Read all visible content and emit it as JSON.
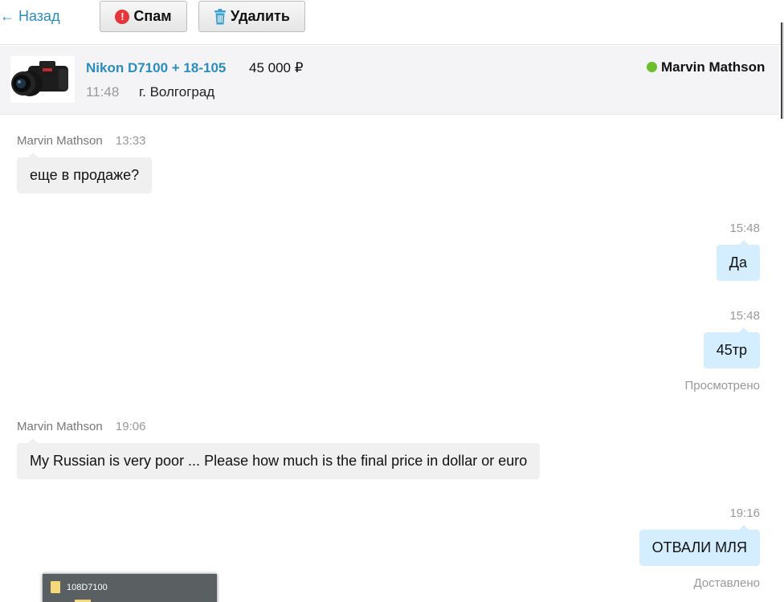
{
  "toolbar": {
    "back_label": "← Назад",
    "spam_label": "Спам",
    "delete_label": "Удалить"
  },
  "item": {
    "title": "Nikon D7100 + 18-105",
    "price": "45 000 ₽",
    "time": "11:48",
    "city": "г. Волгоград",
    "partner_name": "Marvin Mathson",
    "partner_online": true,
    "online_color": "#6cbf2e"
  },
  "messages": [
    {
      "direction": "in",
      "sender": "Marvin Mathson",
      "time": "13:33",
      "text": "еще в продаже?",
      "status": ""
    },
    {
      "direction": "out",
      "sender": "",
      "time": "15:48",
      "text": "Да",
      "status": ""
    },
    {
      "direction": "out",
      "sender": "",
      "time": "15:48",
      "text": "45тр",
      "status": "Просмотрено"
    },
    {
      "direction": "in",
      "sender": "Marvin Mathson",
      "time": "19:06",
      "text": "My Russian is very poor ... Please how much is the final price in dollar or euro",
      "status": ""
    },
    {
      "direction": "out",
      "sender": "",
      "time": "19:16",
      "text": "ОТВАЛИ МЛЯ",
      "status": "Доставлено"
    }
  ],
  "file_popup": {
    "filename": "108D7100"
  },
  "colors": {
    "link": "#2a8cbf",
    "incoming_bubble": "#f0f0f0",
    "outgoing_bubble": "#d5eeff",
    "spam_icon": "#e8343c",
    "trash_icon": "#3aa0d8"
  }
}
